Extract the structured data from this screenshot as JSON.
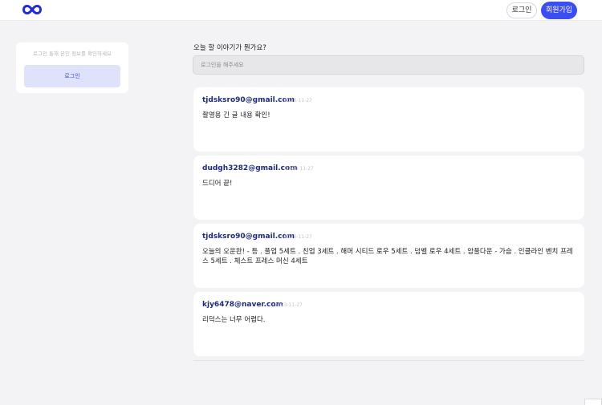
{
  "header": {
    "logo_icon": "infinity-logo-icon",
    "brand_color": "#1f2bd6",
    "login_label": "로그인",
    "signup_label": "회원가입"
  },
  "sidebar": {
    "hint": "로그인 통해 본인 정보를 확인하세요",
    "login_label": "로그인"
  },
  "composer": {
    "question": "오늘 할 이야기가 뭔가요?",
    "placeholder": "로그인을 해주세요"
  },
  "posts": [
    {
      "author": "tjdsksro90@gmail.com",
      "date": "2023-11-27",
      "body": "촬영용 긴 글 내용 확인!"
    },
    {
      "author": "dudgh3282@gmail.com",
      "date": "2023-11-27",
      "body": "드디어 끝!"
    },
    {
      "author": "tjdsksro90@gmail.com",
      "date": "2023-11-27",
      "body": "오늘의 오운완! - 등 . 풀업 5세트 . 친업 3세트 . 해머 시티드 로우 5세트 . 덤벨 로우 4세트 . 암풀다운 - 가슴 . 인클라인 벤치 프레스 5세트 . 체스트 프레스 머신 4세트"
    },
    {
      "author": "kjy6478@naver.com",
      "date": "2023-11-27",
      "body": "리덕스는 너무 어렵다."
    }
  ]
}
